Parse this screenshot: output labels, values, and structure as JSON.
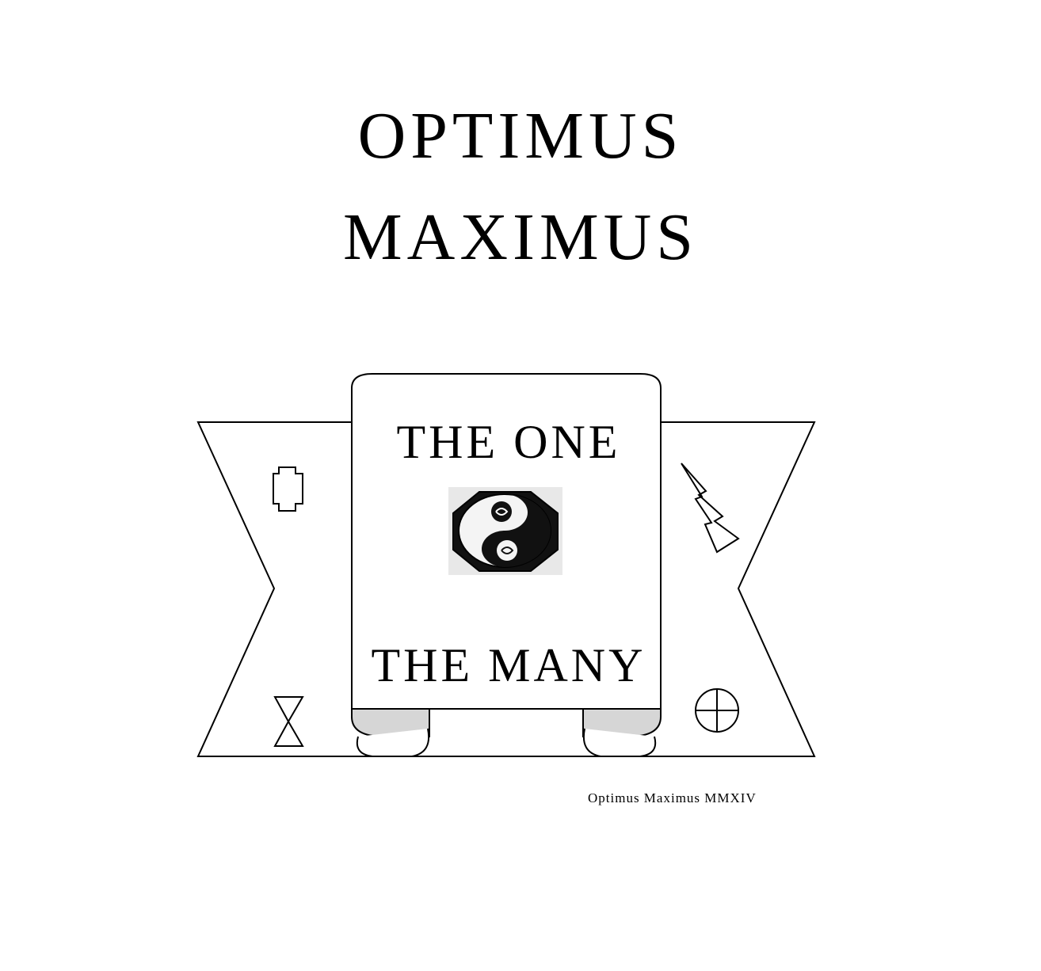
{
  "title": {
    "line1": "OPTIMUS",
    "line2": "MAXIMUS"
  },
  "emblem": {
    "top_text": "THE ONE",
    "bottom_text": "THE MANY",
    "center_image": "yin-yang-icon",
    "left_symbols": [
      "notched-rectangle-icon",
      "hourglass-icon"
    ],
    "right_symbols": [
      "lightning-icon",
      "circled-cross-icon"
    ]
  },
  "credit": "Optimus Maximus  MMXIV",
  "colors": {
    "ink": "#000000",
    "paper": "#ffffff",
    "fold_shade": "#d6d6d6"
  }
}
